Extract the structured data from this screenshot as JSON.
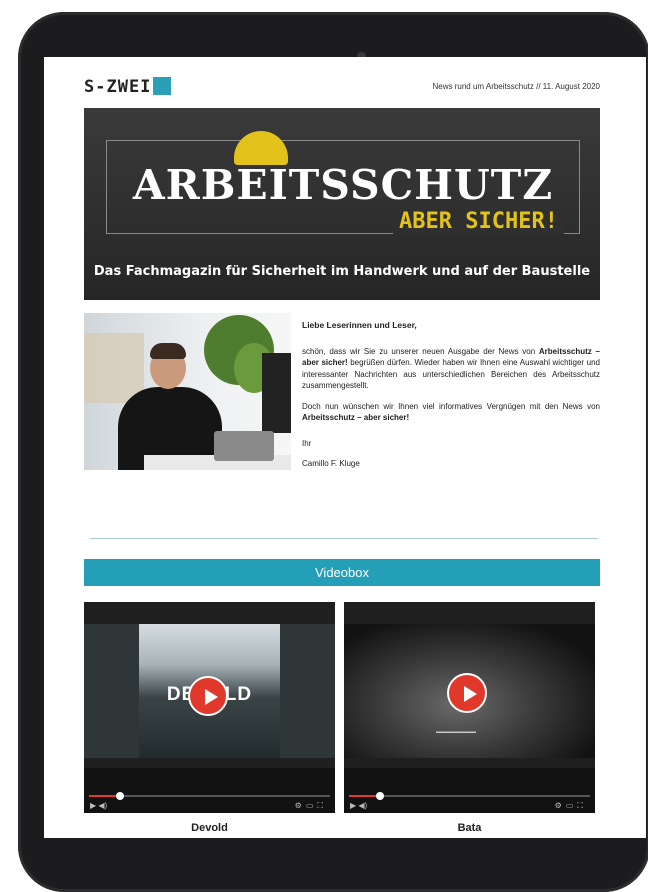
{
  "header": {
    "logo_text": "S-ZWEI",
    "news_line": "News rund um Arbeitsschutz // 11. August 2020"
  },
  "banner": {
    "title": "ARBEITSSCHUTZ",
    "subtitle": "ABER SICHER!",
    "tagline": "Das Fachmagazin für Sicherheit im Handwerk und auf der Baustelle"
  },
  "letter": {
    "greeting": "Liebe Leserinnen und Leser,",
    "p1_a": "schön, dass wir Sie zu unserer neuen Ausgabe der News von ",
    "p1_b": "Arbeitsschutz – aber sicher!",
    "p1_c": " begrüßen dürfen. Wieder haben wir Ihnen eine Auswahl wichtiger und interessanter Nachrichten aus unterschiedlichen Bereichen des Arbeitsschutz zusammengestellt.",
    "p2_a": "Doch nun wünschen wir Ihnen viel informatives Vergnügen mit den News von ",
    "p2_b": "Arbeitsschutz – aber sicher!",
    "sign_ihr": "Ihr",
    "sign_name": "Camillo F. Kluge"
  },
  "videobox": {
    "title": "Videobox",
    "videos": [
      {
        "title": "Devold",
        "overlay": "DEVOLD",
        "progress": 0.12
      },
      {
        "title": "Bata",
        "overlay": "",
        "progress": 0.12
      }
    ]
  },
  "colors": {
    "accent": "#23a0b7",
    "banner_yellow": "#e4c21c",
    "play_red": "#e0392b"
  }
}
